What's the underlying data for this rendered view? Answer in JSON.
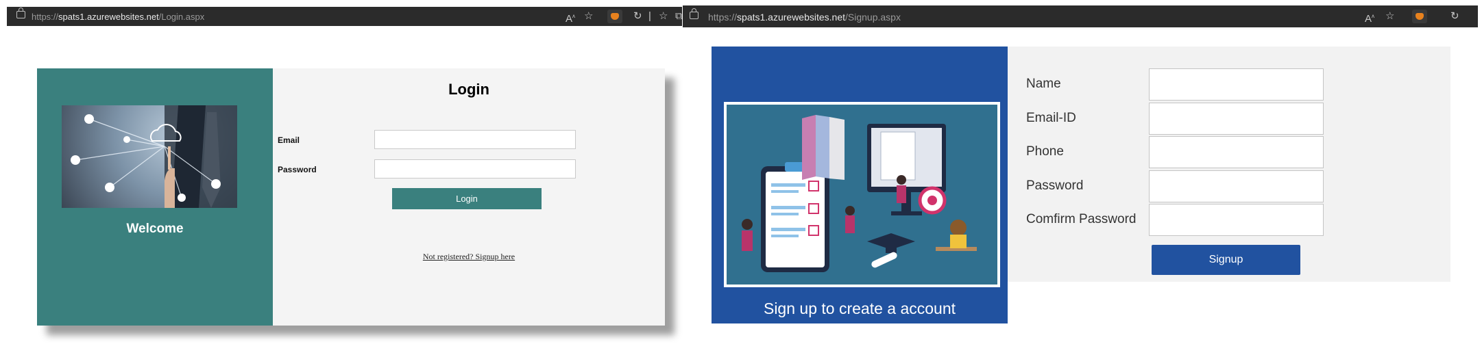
{
  "login_window": {
    "address_bar": {
      "proto": "https://",
      "host": "spats1.azurewebsites.net",
      "path": "/Login.aspx"
    },
    "left_panel": {
      "welcome": "Welcome",
      "image_icon": "cloud-network-touch"
    },
    "title": "Login",
    "email_label": "Email",
    "password_label": "Password",
    "login_button": "Login",
    "register_link": "Not registered? Signup here"
  },
  "signup_window": {
    "address_bar": {
      "proto": "https://",
      "host": "spats1.azurewebsites.net",
      "path": "/Signup.aspx"
    },
    "caption": "Sign up to create a account",
    "fields": [
      "Name",
      "Email-ID",
      "Phone",
      "Password",
      "Comfirm Password"
    ],
    "signup_button": "Signup"
  },
  "colors": {
    "teal": "#3a807e",
    "blue": "#2152a0",
    "panel": "#f4f4f4"
  }
}
